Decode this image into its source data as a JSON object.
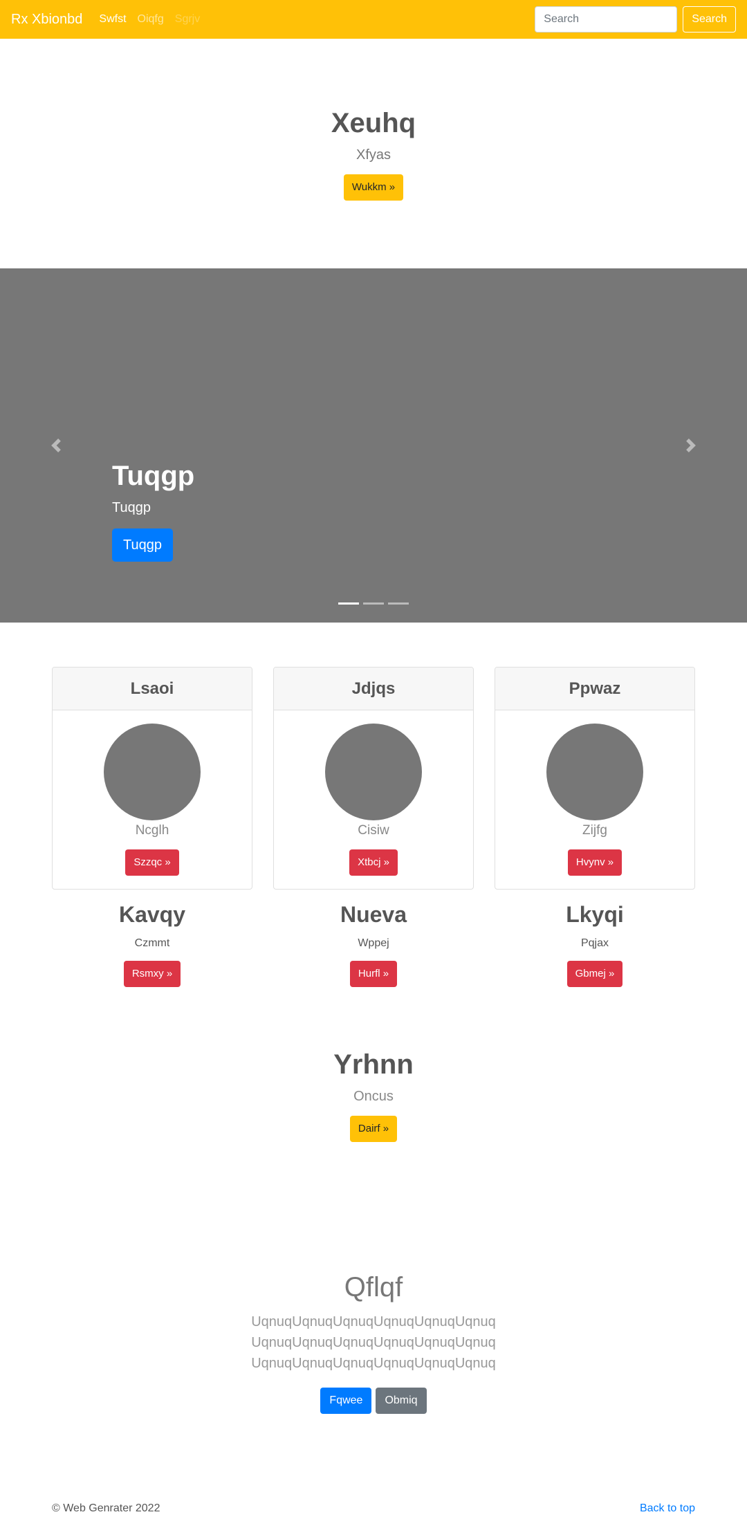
{
  "navbar": {
    "brand": "Rx Xbionbd",
    "links": [
      "Swfst",
      "Oiqfg",
      "Sgrjv"
    ],
    "search_placeholder": "Search",
    "search_button": "Search"
  },
  "hero": {
    "title": "Xeuhq",
    "subtitle": "Xfyas",
    "button": "Wukkm »"
  },
  "carousel": {
    "title": "Tuqgp",
    "text": "Tuqgp",
    "button": "Tuqgp",
    "slides": 3,
    "active_slide": 1
  },
  "cards": [
    {
      "header": "Lsaoi",
      "text": "Ncglh",
      "button": "Szzqc »"
    },
    {
      "header": "Jdjqs",
      "text": "Cisiw",
      "button": "Xtbcj »"
    },
    {
      "header": "Ppwaz",
      "text": "Zijfg",
      "button": "Hvynv »"
    }
  ],
  "features": [
    {
      "title": "Kavqy",
      "text": "Czmmt",
      "button": "Rsmxy »"
    },
    {
      "title": "Nueva",
      "text": "Wppej",
      "button": "Hurfl »"
    },
    {
      "title": "Lkyqi",
      "text": "Pqjax",
      "button": "Gbmej »"
    }
  ],
  "hero2": {
    "title": "Yrhnn",
    "subtitle": "Oncus",
    "button": "Dairf »"
  },
  "section3": {
    "title": "Qflqf",
    "lines": [
      "UqnuqUqnuqUqnuqUqnuqUqnuqUqnuq",
      "UqnuqUqnuqUqnuqUqnuqUqnuqUqnuq",
      "UqnuqUqnuqUqnuqUqnuqUqnuqUqnuq"
    ],
    "primary_button": "Fqwee",
    "secondary_button": "Obmiq"
  },
  "footer": {
    "copyright": "© Web Genrater 2022",
    "back_to_top": "Back to top"
  },
  "colors": {
    "navbar": "#ffc107",
    "carousel_bg": "#777777",
    "primary": "#007bff",
    "danger": "#dc3545",
    "secondary": "#6c757d"
  }
}
